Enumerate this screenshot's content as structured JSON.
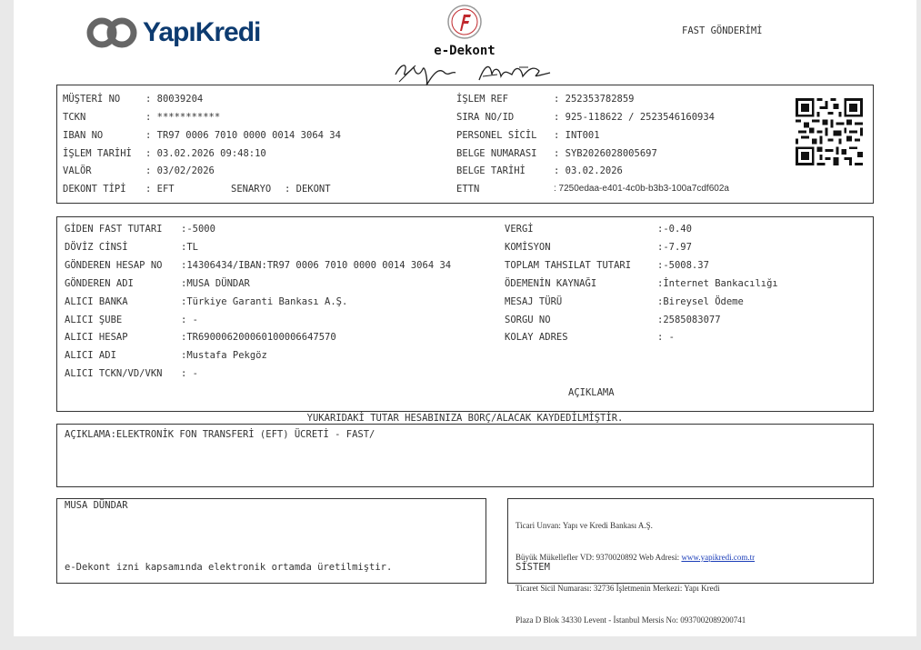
{
  "header": {
    "bank_name": "YapıKredi",
    "doc_title": "e-Dekont",
    "doc_type": "FAST GÖNDERİMİ"
  },
  "top": {
    "musteri_no_label": "MÜŞTERİ NO",
    "musteri_no": ": 80039204",
    "tckn_label": "TCKN",
    "tckn": ": ***********",
    "iban_label": "IBAN NO",
    "iban": ": TR97 0006 7010 0000 0014 3064 34",
    "islem_tarihi_label": "İŞLEM TARİHİ",
    "islem_tarihi": ": 03.02.2026 09:48:10",
    "valor_label": "VALÖR",
    "valor": ": 03/02/2026",
    "dekont_tipi_label": "DEKONT TİPİ",
    "dekont_tipi": ": EFT",
    "senaryo_label": "SENARYO",
    "senaryo": ": DEKONT",
    "islem_ref_label": "İŞLEM REF",
    "islem_ref": ": 252353782859",
    "sira_no_label": "SIRA NO/ID",
    "sira_no": ": 925-118622 / 2523546160934",
    "personel_label": "PERSONEL SİCİL",
    "personel": ": INT001",
    "belge_no_label": "BELGE NUMARASI",
    "belge_no": ": SYB2026028005697",
    "belge_tarihi_label": "BELGE TARİHİ",
    "belge_tarihi": ": 03.02.2026",
    "ettn_label": "ETTN",
    "ettn": ": 7250edaa-e401-4c0b-b3b3-100a7cdf602a"
  },
  "details": {
    "left": [
      {
        "label": "GİDEN FAST TUTARI",
        "value": ":-5000"
      },
      {
        "label": "DÖVİZ CİNSİ",
        "value": ":TL"
      },
      {
        "label": "GÖNDEREN HESAP NO",
        "value": ":14306434/IBAN:TR97 0006 7010 0000 0014 3064 34"
      },
      {
        "label": "GÖNDEREN ADI",
        "value": ":MUSA DÜNDAR"
      },
      {
        "label": "ALICI BANKA",
        "value": ":Türkiye Garanti Bankası A.Ş."
      },
      {
        "label": "ALICI ŞUBE",
        "value": ": -"
      },
      {
        "label": "ALICI HESAP",
        "value": ":TR690006200060100006647570"
      },
      {
        "label": "ALICI ADI",
        "value": ":Mustafa Pekgöz"
      },
      {
        "label": "ALICI TCKN/VD/VKN",
        "value": ": -"
      }
    ],
    "right": [
      {
        "label": "VERGİ",
        "value": ":-0.40"
      },
      {
        "label": "KOMİSYON",
        "value": ":-7.97"
      },
      {
        "label": "TOPLAM TAHSILAT TUTARI",
        "value": ":-5008.37"
      },
      {
        "label": "ÖDEMENİN KAYNAĞI",
        "value": ":İnternet Bankacılığı"
      },
      {
        "label": "MESAJ TÜRÜ",
        "value": ":Bireysel Ödeme"
      },
      {
        "label": "SORGU NO",
        "value": ":2585083077"
      },
      {
        "label": "KOLAY ADRES",
        "value": ": -"
      }
    ],
    "aciklama_title": "AÇIKLAMA"
  },
  "notice": "YUKARIDAKİ TUTAR HESABINIZA BORÇ/ALACAK KAYDEDİLMİŞTİR.",
  "description": "AÇIKLAMA:ELEKTRONİK FON TRANSFERİ (EFT) ÜCRETİ - FAST/",
  "footer": {
    "customer_name": "MUSA DÜNDAR",
    "permit_text": "e-Dekont izni kapsamında elektronik ortamda üretilmiştir.",
    "line1": "Ticari Unvan: Yapı ve Kredi Bankası A.Ş.",
    "line2_prefix": "Büyük Mükellefler VD: 9370020892 Web Adresi: ",
    "web": "www.yapikredi.com.tr",
    "line3": "Ticaret Sicil Numarası: 32736 İşletmenin Merkezi: Yapı Kredi",
    "line4": "Plaza D Blok 34330 Levent - İstanbul Mersis No: 0937002089200741",
    "system": "SİSTEM"
  }
}
